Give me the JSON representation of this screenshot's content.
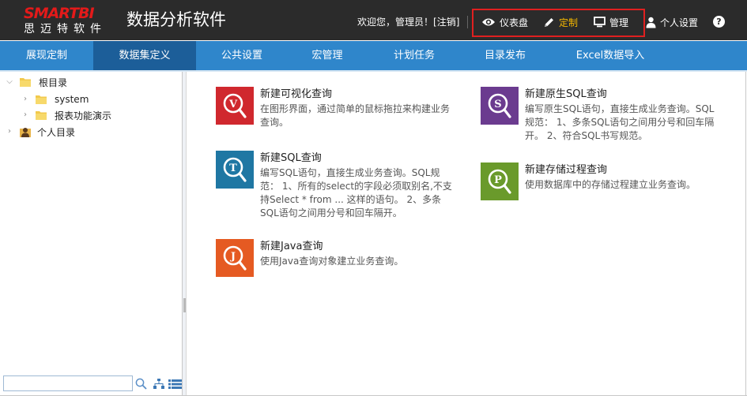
{
  "header": {
    "logo_text": "SMARTBI",
    "logo_sub": "思迈特软件",
    "app_title": "数据分析软件",
    "welcome": "欢迎您，管理员！",
    "logout_label": "[注销]",
    "actions": [
      {
        "label": "仪表盘",
        "icon": "eye-icon"
      },
      {
        "label": "定制",
        "icon": "pencil-icon",
        "active": true
      },
      {
        "label": "管理",
        "icon": "monitor-icon"
      }
    ],
    "settings_label": "个人设置",
    "help_label": "?",
    "colors": {
      "bar": "#2b2b2b",
      "accent": "#f5b800",
      "highlight_box": "#e02020"
    }
  },
  "nav": {
    "items": [
      {
        "label": "展现定制"
      },
      {
        "label": "数据集定义",
        "active": true
      },
      {
        "label": "公共设置"
      },
      {
        "label": "宏管理"
      },
      {
        "label": "计划任务"
      },
      {
        "label": "目录发布"
      },
      {
        "label": "Excel数据导入"
      }
    ],
    "colors": {
      "bar": "#2f86cb",
      "active": "#1c5e99"
    }
  },
  "tree": {
    "root": "根目录",
    "children": [
      "system",
      "报表功能演示"
    ],
    "personal": "个人目录",
    "search_placeholder": ""
  },
  "cards": [
    {
      "title": "新建可视化查询",
      "desc": "在图形界面，通过简单的鼠标拖拉来构建业务查询。",
      "letter": "V",
      "color": "#d0282e",
      "icon": "v-icon"
    },
    {
      "title": "新建原生SQL查询",
      "desc": "编写原生SQL语句，直接生成业务查询。SQL规范：  1、多条SQL语句之间用分号和回车隔开。  2、符合SQL书写规范。",
      "letter": "S",
      "color": "#6b3b8f",
      "icon": "s-icon"
    },
    {
      "title": "新建SQL查询",
      "desc": "编写SQL语句，直接生成业务查询。SQL规范：  1、所有的select的字段必须取别名,不支持Select * from ... 这样的语句。  2、多条SQL语句之间用分号和回车隔开。",
      "letter": "T",
      "color": "#1f77a3",
      "icon": "t-icon"
    },
    {
      "title": "新建存储过程查询",
      "desc": "使用数据库中的存储过程建立业务查询。",
      "letter": "P",
      "color": "#6a9a2b",
      "icon": "p-icon"
    },
    {
      "title": "新建Java查询",
      "desc": "使用Java查询对象建立业务查询。",
      "letter": "J",
      "color": "#e55a22",
      "icon": "j-icon"
    }
  ]
}
